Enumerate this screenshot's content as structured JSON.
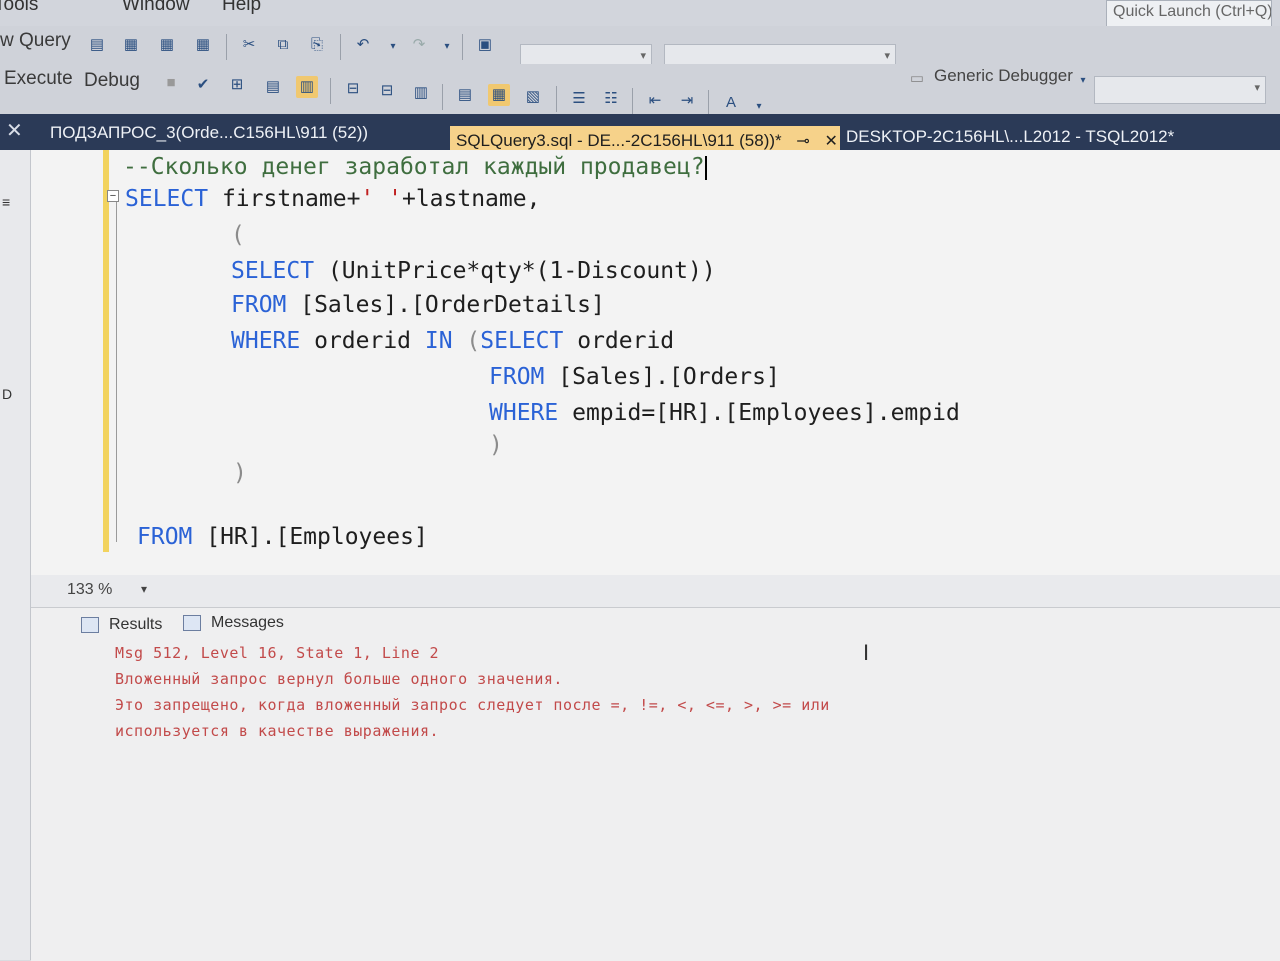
{
  "menu": {
    "tools": "Tools",
    "window": "Window",
    "help": "Help",
    "quick_launch_placeholder": "Quick Launch (Ctrl+Q)"
  },
  "toolbar": {
    "new_query": "w Query",
    "execute": "Execute",
    "debug": "Debug",
    "debugger": "Generic Debugger"
  },
  "tabs": [
    {
      "label": "ПОДЗАПРОС_3(Orde...C156HL\\911 (52))"
    },
    {
      "label": "SQLQuery3.sql - DE...-2C156HL\\911 (58))*",
      "active": true
    },
    {
      "label": "DESKTOP-2C156HL\\...L2012 - TSQL2012*"
    }
  ],
  "left_strip": {
    "mark1": "≡",
    "mark2": "D"
  },
  "editor": {
    "line1": "--Сколько денег заработал каждый продавец?",
    "line2_kw": "SELECT",
    "line2_rest": " firstname+",
    "line2_str": "' '",
    "line2_end": "+lastname,",
    "line3": "(",
    "line4_kw": "SELECT",
    "line4_rest": " (UnitPrice*qty*(1-Discount))",
    "line5_kw": "FROM",
    "line5_rest": " [Sales].[OrderDetails]",
    "line6_kw": "WHERE",
    "line6_rest": " orderid ",
    "line6_in": "IN",
    "line6_paren": " (",
    "line6_kw2": "SELECT",
    "line6_end": " orderid",
    "line7_kw": "FROM",
    "line7_rest": " [Sales].[Orders]",
    "line8_kw": "WHERE",
    "line8_rest": " empid=[HR].[Employees].empid",
    "line9": ")",
    "line10": ")",
    "line11_kw": "FROM",
    "line11_rest": " [HR].[Employees]"
  },
  "zoom": {
    "value": "133 %"
  },
  "results": {
    "tab_results": "Results",
    "tab_messages": "Messages",
    "msg1": "Msg 512, Level 16, State 1, Line 2",
    "msg2": "Вложенный запрос вернул больше одного значения.",
    "msg3": "Это запрещено, когда вложенный запрос следует после =, !=, <, <=, >, >= или",
    "msg4": "используется в качестве выражения."
  }
}
